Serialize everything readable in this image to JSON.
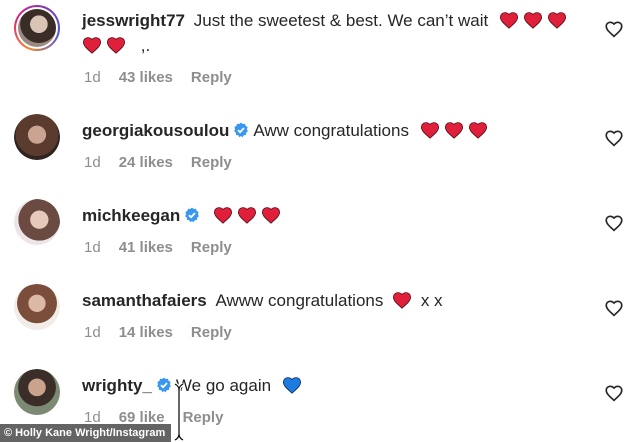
{
  "comments": [
    {
      "username": "jesswright77",
      "verified": false,
      "text": "Just the sweetest & best. We can’t wait",
      "text_line2": ",.",
      "time": "1d",
      "likes": "43 likes",
      "reply": "Reply"
    },
    {
      "username": "georgiakousoulou",
      "verified": true,
      "text": "Aww congratulations",
      "time": "1d",
      "likes": "24 likes",
      "reply": "Reply"
    },
    {
      "username": "michkeegan",
      "verified": true,
      "text": "",
      "time": "1d",
      "likes": "41 likes",
      "reply": "Reply"
    },
    {
      "username": "samanthafaiers",
      "verified": false,
      "text": "Awww congratulations",
      "text_after": "x x",
      "time": "1d",
      "likes": "14 likes",
      "reply": "Reply"
    },
    {
      "username": "wrighty_",
      "verified": true,
      "text": "We go again",
      "time": "1d",
      "likes": "69 like",
      "reply": "Reply"
    }
  ],
  "credit": "© Holly Kane Wright/Instagram",
  "colors": {
    "heart_red": "#e0203a",
    "heart_blue": "#1e7be0",
    "verified_blue": "#3897f0",
    "meta_grey": "#8e8e8e"
  },
  "icons": {
    "like": "heart-outline-icon",
    "verified": "verified-badge-icon"
  }
}
